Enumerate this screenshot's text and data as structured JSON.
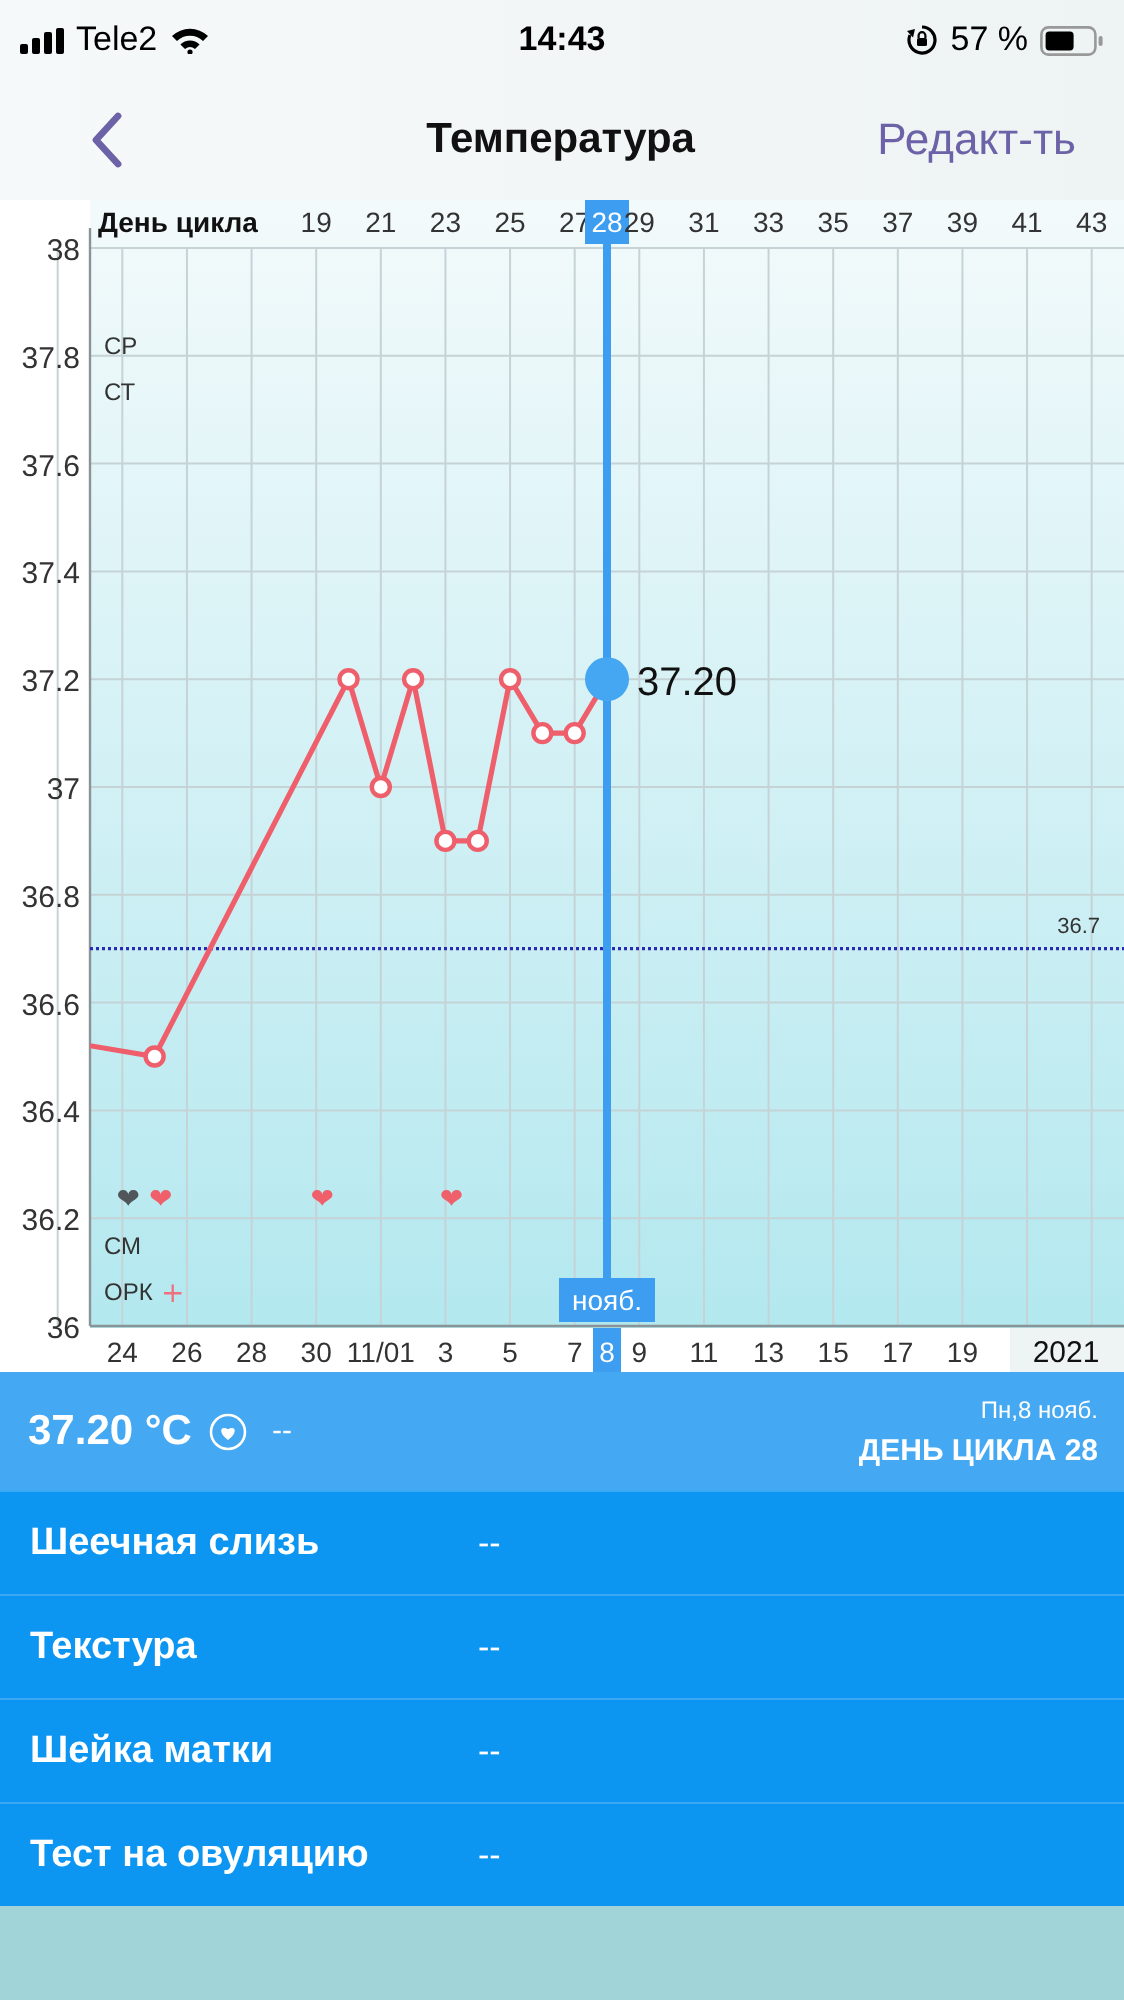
{
  "status_bar": {
    "carrier": "Tele2",
    "time": "14:43",
    "battery": "57 %"
  },
  "nav": {
    "title": "Температура",
    "action": "Редакт-ть"
  },
  "chart": {
    "cycle_day_title": "День цикла",
    "row_labels": [
      "СР",
      "СТ",
      "СМ",
      "ОРК"
    ],
    "year": "2021",
    "month_label": "нояб.",
    "value_label": "37.20",
    "cycle_tick_states": [
      {
        "selected": false
      },
      {
        "selected": false
      },
      {
        "selected": false
      },
      {
        "selected": false
      },
      {
        "selected": false
      },
      {
        "selected": true
      },
      {
        "selected": false
      },
      {
        "selected": false
      },
      {
        "selected": false
      },
      {
        "selected": false
      },
      {
        "selected": false
      },
      {
        "selected": false
      },
      {
        "selected": false
      },
      {
        "selected": false
      }
    ],
    "day_marks": [
      {
        "kind": "heart",
        "color": "#50565a"
      },
      {
        "kind": "heart-plus",
        "color": "#f0606a"
      },
      {
        "kind": "blank"
      },
      {
        "kind": "blank"
      },
      {
        "kind": "blank"
      },
      {
        "kind": "blank"
      },
      {
        "kind": "heart",
        "color": "#f0606a"
      },
      {
        "kind": "blank"
      },
      {
        "kind": "blank"
      },
      {
        "kind": "blank"
      },
      {
        "kind": "heart",
        "color": "#f0606a"
      }
    ],
    "heart_glyph": "❤",
    "plus_glyph": "+",
    "date_labels": [
      {
        "label": "24",
        "selected": false
      },
      {
        "label": "26",
        "selected": false
      },
      {
        "label": "28",
        "selected": false
      },
      {
        "label": "30",
        "selected": false
      },
      {
        "label": "11/01",
        "selected": false
      },
      {
        "label": "3",
        "selected": false
      },
      {
        "label": "5",
        "selected": false
      },
      {
        "label": "7",
        "selected": false
      },
      {
        "label": "8",
        "selected": true
      },
      {
        "label": "9",
        "selected": false
      },
      {
        "label": "11",
        "selected": false
      },
      {
        "label": "13",
        "selected": false
      },
      {
        "label": "15",
        "selected": false
      },
      {
        "label": "17",
        "selected": false
      },
      {
        "label": "19",
        "selected": false
      }
    ],
    "chart_data": {
      "type": "line",
      "x": [
        12,
        14,
        20,
        21,
        22,
        23,
        24,
        25,
        26,
        27,
        28
      ],
      "grid": true,
      "series": [
        {
          "color": "#ee5f6b",
          "marker": "o",
          "values": [
            36.52,
            36.5,
            37.2,
            37.0,
            37.2,
            36.9,
            36.9,
            37.2,
            37.1,
            37.1,
            37.2
          ]
        }
      ],
      "xlim": [
        12,
        44
      ],
      "ylim": [
        36,
        38
      ],
      "xticks": [
        {
          "value": 19,
          "label": "19"
        },
        {
          "value": 21,
          "label": "21"
        },
        {
          "value": 23,
          "label": "23"
        },
        {
          "value": 25,
          "label": "25"
        },
        {
          "value": 27,
          "label": "27"
        },
        {
          "value": 28,
          "label": "28"
        },
        {
          "value": 29,
          "label": "29"
        },
        {
          "value": 31,
          "label": "31"
        },
        {
          "value": 33,
          "label": "33"
        },
        {
          "value": 35,
          "label": "35"
        },
        {
          "value": 37,
          "label": "37"
        },
        {
          "value": 39,
          "label": "39"
        },
        {
          "value": 41,
          "label": "41"
        },
        {
          "value": 43,
          "label": "43"
        }
      ],
      "yticks": [
        {
          "value": 36,
          "label": "36"
        },
        {
          "value": 36.2,
          "label": "36.2"
        },
        {
          "value": 36.4,
          "label": "36.4"
        },
        {
          "value": 36.6,
          "label": "36.6"
        },
        {
          "value": 36.8,
          "label": "36.8"
        },
        {
          "value": 37,
          "label": "37"
        },
        {
          "value": 37.2,
          "label": "37.2"
        },
        {
          "value": 37.4,
          "label": "37.4"
        },
        {
          "value": 37.6,
          "label": "37.6"
        },
        {
          "value": 37.8,
          "label": "37.8"
        },
        {
          "value": 38,
          "label": "38"
        }
      ],
      "ref_lines": [
        {
          "axis": "y",
          "value": 36.7,
          "label": "36.7"
        },
        {
          "axis": "x",
          "value": 28
        }
      ]
    }
  },
  "summary": {
    "temperature": "37.20 °C",
    "note": "--",
    "date": "Пн,8 нояб.",
    "cycle_day": "ДЕНЬ ЦИКЛА 28"
  },
  "rows": [
    {
      "label": "Шеечная слизь",
      "value": "--"
    },
    {
      "label": "Текстура",
      "value": "--"
    },
    {
      "label": "Шейка матки",
      "value": "--"
    },
    {
      "label": "Тест на овуляцию",
      "value": "--"
    }
  ]
}
